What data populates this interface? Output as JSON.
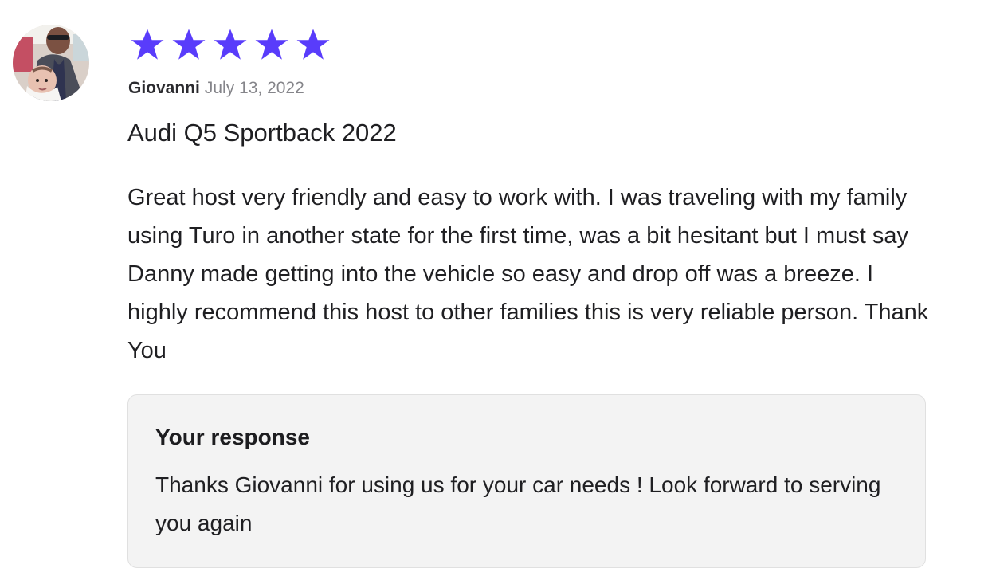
{
  "review": {
    "rating": 5,
    "rating_max": 5,
    "star_icon": "star-icon",
    "star_color": "#593cfb",
    "reviewer": "Giovanni",
    "date": "July 13, 2022",
    "car": "Audi Q5 Sportback 2022",
    "text": "Great host very friendly and easy to work with. I was traveling with my family using Turo in another state for the first time, was a bit hesitant but I must say Danny made getting into the vehicle so easy and drop off was a breeze. I highly recommend this host to other families this is very reliable person. Thank You"
  },
  "response": {
    "title": "Your response",
    "text": "Thanks Giovanni for using us for your car needs ! Look forward to serving you again"
  }
}
